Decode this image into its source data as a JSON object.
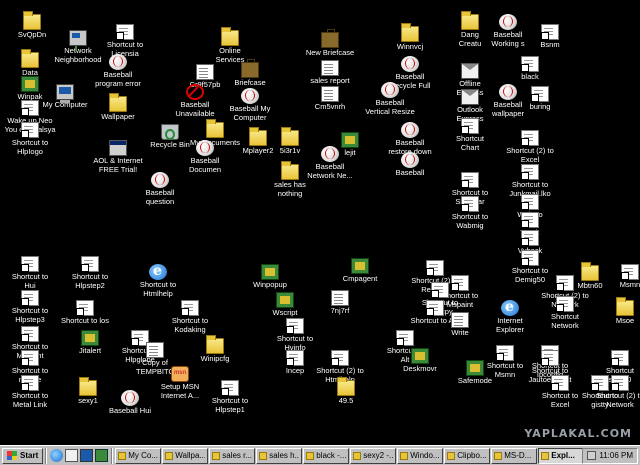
{
  "desktop": {
    "icons": [
      {
        "label": "SvQpDn",
        "icon": "folder-icon",
        "kind": "folder"
      },
      {
        "label": "Shortcut to\nLicensia",
        "icon": "shortcut-icon",
        "kind": "shortcut"
      },
      {
        "label": "Network\nNeighborhood",
        "icon": "network-neighborhood-icon",
        "kind": "network"
      },
      {
        "label": "Online\nServices",
        "icon": "folder-icon",
        "kind": "folder"
      },
      {
        "label": "New Briefcase",
        "icon": "briefcase-icon",
        "kind": "briefcase"
      },
      {
        "label": "Winnvcj",
        "icon": "folder-icon",
        "kind": "folder"
      },
      {
        "label": "Dang\nCreatu",
        "icon": "folder-icon",
        "kind": "folder"
      },
      {
        "label": "Baseball\nWorking s",
        "icon": "baseball-icon",
        "kind": "ball"
      },
      {
        "label": "Bsnm",
        "icon": "shortcut-icon",
        "kind": "shortcut"
      },
      {
        "label": "Data",
        "icon": "folder-icon",
        "kind": "folder"
      },
      {
        "label": "Baseball\nprogram error",
        "icon": "baseball-icon",
        "kind": "ball"
      },
      {
        "label": "Cr9f57pb",
        "icon": "document-icon",
        "kind": "sheet"
      },
      {
        "label": "Briefcase",
        "icon": "briefcase-icon",
        "kind": "briefcase"
      },
      {
        "label": "sales report",
        "icon": "document-icon",
        "kind": "sheet"
      },
      {
        "label": "Baseball\nRecycle Full",
        "icon": "baseball-icon",
        "kind": "ball"
      },
      {
        "label": "Offline\nExpress",
        "icon": "mail-icon",
        "kind": "mail"
      },
      {
        "label": "black",
        "icon": "shortcut-icon",
        "kind": "shortcut"
      },
      {
        "label": "Winpak",
        "icon": "app-icon",
        "kind": "app"
      },
      {
        "label": "My Computer",
        "icon": "my-computer-icon",
        "kind": "computer"
      },
      {
        "label": "Baseball\nUnavailable",
        "icon": "no-entry-icon",
        "kind": "red"
      },
      {
        "label": "Baseball My\nComputer",
        "icon": "baseball-icon",
        "kind": "ball"
      },
      {
        "label": "Cm5vnrh",
        "icon": "document-icon",
        "kind": "sheet"
      },
      {
        "label": "Baseball\nVertical Resize",
        "icon": "baseball-icon",
        "kind": "ball"
      },
      {
        "label": "Outlook\nExpress",
        "icon": "mail-icon",
        "kind": "mail"
      },
      {
        "label": "Baseball\nwallpaper",
        "icon": "baseball-icon",
        "kind": "ball"
      },
      {
        "label": "buring",
        "icon": "shortcut-icon",
        "kind": "shortcut"
      },
      {
        "label": "Wake up Neo\nYou obosralsya",
        "icon": "shortcut-icon",
        "kind": "shortcut"
      },
      {
        "label": "Wallpaper",
        "icon": "folder-icon",
        "kind": "folder"
      },
      {
        "label": "Shortcut to\nHlpIogo",
        "icon": "shortcut-icon",
        "kind": "shortcut"
      },
      {
        "label": "AOL & Internet\nFREE Trial!",
        "icon": "aol-icon",
        "kind": "exe"
      },
      {
        "label": "Recycle Bin",
        "icon": "recycle-bin-icon",
        "kind": "recycle"
      },
      {
        "label": "My Documents",
        "icon": "folder-icon",
        "kind": "folder"
      },
      {
        "label": "Mplayer2",
        "icon": "folder-icon",
        "kind": "folder"
      },
      {
        "label": "5i3r1v",
        "icon": "folder-icon",
        "kind": "folder"
      },
      {
        "label": "lejit",
        "icon": "app-icon",
        "kind": "app"
      },
      {
        "label": "Baseball\nrestore down",
        "icon": "baseball-icon",
        "kind": "ball"
      },
      {
        "label": "Shortcut\nChart",
        "icon": "shortcut-icon",
        "kind": "shortcut"
      },
      {
        "label": "Shortcut (2) to\nExcel",
        "icon": "shortcut-icon",
        "kind": "shortcut"
      },
      {
        "label": "Baseball\nDocumen",
        "icon": "baseball-icon",
        "kind": "ball"
      },
      {
        "label": "Baseball\nNetwork Ne...",
        "icon": "baseball-icon",
        "kind": "ball"
      },
      {
        "label": "Baseball",
        "icon": "baseball-icon",
        "kind": "ball"
      },
      {
        "label": "Shortcut to\nJunkmail.lko",
        "icon": "shortcut-icon",
        "kind": "shortcut"
      },
      {
        "label": "Baseball\nquestion",
        "icon": "baseball-icon",
        "kind": "ball"
      },
      {
        "label": "sales has\nnothing",
        "icon": "folder-icon",
        "kind": "folder"
      },
      {
        "label": "Shortcut to\nShowvar",
        "icon": "shortcut-icon",
        "kind": "shortcut"
      },
      {
        "label": "Wulogo\nWab",
        "icon": "shortcut-icon",
        "kind": "shortcut"
      },
      {
        "label": "Shortcut to\nWabmig",
        "icon": "shortcut-icon",
        "kind": "shortcut"
      },
      {
        "label": "Wunk",
        "icon": "shortcut-icon",
        "kind": "shortcut"
      },
      {
        "label": "Vvback",
        "icon": "shortcut-icon",
        "kind": "shortcut"
      },
      {
        "label": "Shortcut to\nDemig50",
        "icon": "shortcut-icon",
        "kind": "shortcut"
      },
      {
        "label": "Shortcut to\nHui",
        "icon": "shortcut-icon",
        "kind": "shortcut"
      },
      {
        "label": "Shortcut to\nHlpstep2",
        "icon": "shortcut-icon",
        "kind": "shortcut"
      },
      {
        "label": "Shortcut to\nHtmlhelp",
        "icon": "ie-icon",
        "kind": "ie"
      },
      {
        "label": "Winpopup",
        "icon": "app-icon",
        "kind": "app"
      },
      {
        "label": "Cmpagent",
        "icon": "app-icon",
        "kind": "app"
      },
      {
        "label": "Shortcut (2) to\nRegistry",
        "icon": "shortcut-icon",
        "kind": "shortcut"
      },
      {
        "label": "Shortcut to\nMspaint",
        "icon": "shortcut-icon",
        "kind": "shortcut"
      },
      {
        "label": "Shortcut (2) to\nNetwork",
        "icon": "shortcut-icon",
        "kind": "shortcut"
      },
      {
        "label": "Mbtn60",
        "icon": "folder-icon",
        "kind": "folder"
      },
      {
        "label": "Msmn",
        "icon": "shortcut-icon",
        "kind": "shortcut"
      },
      {
        "label": "Shortcut to\nHlpstep3",
        "icon": "shortcut-icon",
        "kind": "shortcut"
      },
      {
        "label": "Shortcut to los",
        "icon": "shortcut-icon",
        "kind": "shortcut"
      },
      {
        "label": "Shortcut to\nKodaking",
        "icon": "shortcut-icon",
        "kind": "shortcut"
      },
      {
        "label": "Wscript",
        "icon": "app-icon",
        "kind": "app"
      },
      {
        "label": "7nj7rf",
        "icon": "document-icon",
        "kind": "sheet"
      },
      {
        "label": "Shortcut to\nHpdcpy",
        "icon": "shortcut-icon",
        "kind": "shortcut"
      },
      {
        "label": "Shortcut to Aol",
        "icon": "shortcut-icon",
        "kind": "shortcut"
      },
      {
        "label": "Write",
        "icon": "document-icon",
        "kind": "sheet"
      },
      {
        "label": "Internet\nExplorer",
        "icon": "internet-explorer-icon",
        "kind": "ie"
      },
      {
        "label": "Shortcut\nNetwork",
        "icon": "shortcut-icon",
        "kind": "shortcut"
      },
      {
        "label": "Msoe",
        "icon": "folder-icon",
        "kind": "folder"
      },
      {
        "label": "Shortcut to\nMm2ent",
        "icon": "shortcut-icon",
        "kind": "shortcut"
      },
      {
        "label": "Shortcut to\nHlpglobe",
        "icon": "shortcut-icon",
        "kind": "shortcut"
      },
      {
        "label": "Shortcut to\nHvinfo",
        "icon": "shortcut-icon",
        "kind": "shortcut"
      },
      {
        "label": "Shortcut to\nAlt",
        "icon": "shortcut-icon",
        "kind": "shortcut"
      },
      {
        "label": "Deskmovr",
        "icon": "app-icon",
        "kind": "app"
      },
      {
        "label": "Shortcut to\nMsmn",
        "icon": "shortcut-icon",
        "kind": "shortcut"
      },
      {
        "label": "Shortcut to\nIpconfig",
        "icon": "shortcut-icon",
        "kind": "shortcut"
      },
      {
        "label": "Shortcut to\nmouse",
        "icon": "shortcut-icon",
        "kind": "shortcut"
      },
      {
        "label": "Jitalert",
        "icon": "app-icon",
        "kind": "app"
      },
      {
        "label": "Copy of\nTEMPBITC",
        "icon": "document-icon",
        "kind": "sheet"
      },
      {
        "label": "Winipcfg",
        "icon": "folder-icon",
        "kind": "folder"
      },
      {
        "label": "Shortcut (2) to\nHtmlhelp",
        "icon": "shortcut-icon",
        "kind": "shortcut"
      },
      {
        "label": "Safemode",
        "icon": "app-icon",
        "kind": "app"
      },
      {
        "label": "Shortcut to\nJautoexp.dat",
        "icon": "shortcut-icon",
        "kind": "shortcut"
      },
      {
        "label": "Shortcut to\nMetal Link",
        "icon": "shortcut-icon",
        "kind": "shortcut"
      },
      {
        "label": "sexy1",
        "icon": "folder-icon",
        "kind": "folder"
      },
      {
        "label": "Baseball Hui",
        "icon": "baseball-icon",
        "kind": "ball"
      },
      {
        "label": "Setup MSN\nInternet A...",
        "icon": "msn-icon",
        "kind": "msn"
      },
      {
        "label": "Shortcut to\nHlpstep1",
        "icon": "shortcut-icon",
        "kind": "shortcut"
      },
      {
        "label": "Incep",
        "icon": "shortcut-icon",
        "kind": "shortcut"
      },
      {
        "label": "49.5",
        "icon": "folder-icon",
        "kind": "folder"
      },
      {
        "label": "Shortcut to\nExcel",
        "icon": "shortcut-icon",
        "kind": "shortcut"
      },
      {
        "label": "Shortcut to\ngistty",
        "icon": "shortcut-icon",
        "kind": "shortcut"
      },
      {
        "label": "Shortcut\nstup50",
        "icon": "shortcut-icon",
        "kind": "shortcut"
      },
      {
        "label": "Shortcut (2) to\nNetwork",
        "icon": "shortcut-icon",
        "kind": "shortcut"
      }
    ]
  },
  "taskbar": {
    "start_label": "Start",
    "quick_launch": [
      "ie-icon",
      "outlook-icon",
      "desktop-icon",
      "channels-icon"
    ],
    "tasks": [
      {
        "label": "My Co...",
        "active": false
      },
      {
        "label": "Wallpa...",
        "active": false
      },
      {
        "label": "sales r...",
        "active": false
      },
      {
        "label": "sales h...",
        "active": false
      },
      {
        "label": "black -...",
        "active": false
      },
      {
        "label": "sexy2 -...",
        "active": false
      },
      {
        "label": "Windo...",
        "active": false
      },
      {
        "label": "Clipbo...",
        "active": false
      },
      {
        "label": "MS-D...",
        "active": false
      },
      {
        "label": "Expl...",
        "active": true
      }
    ],
    "clock": "11:06 PM"
  },
  "watermark": "YAPLAKAL.COM"
}
